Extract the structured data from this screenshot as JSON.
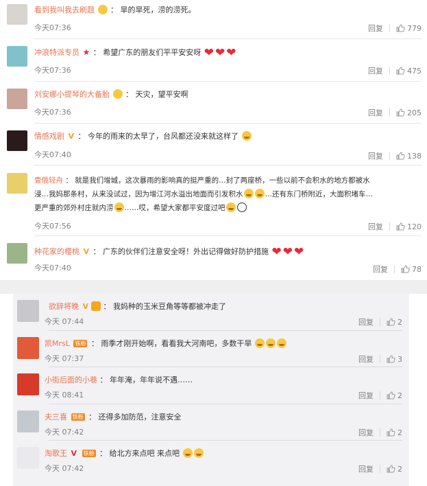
{
  "top_comments": [
    {
      "user": "看到我叫我去刷题",
      "badge": "emoji",
      "text": "旱的旱死，涝的涝死。",
      "time": "今天07:36",
      "reply": "回复",
      "likes": "779",
      "avatar_color": "#d8d4cf"
    },
    {
      "user": "冲浪特派专员",
      "badge": "star",
      "text": "希望广东的朋友们平平安安呀",
      "hearts": 3,
      "time": "今天07:36",
      "reply": "回复",
      "likes": "475",
      "avatar_color": "#7fc2c9"
    },
    {
      "user": "刘安娜小提琴的大备胎",
      "badge": "emoji",
      "text": "天灾，望平安啊",
      "time": "今天07:36",
      "reply": "回复",
      "likes": "205",
      "avatar_color": "#c9a59a"
    },
    {
      "user": "情感戏剧",
      "badge": "v",
      "text": "今年的雨来的太早了，台风都还没来就这样了",
      "time": "今天07:40",
      "reply": "回复",
      "likes": "138",
      "avatar_color": "#2a1a1c"
    },
    {
      "user": "壹俄轻舟",
      "badge": "",
      "text": "就是我们增城，这次暴雨的影响真的挺严重的…封了两座桥，一些以前不会积水的地方都被水",
      "text2": "浸…我妈那条村，从来没试过，因为增江河水溢出地面而引发积水",
      "text2b": "…还有东门桥附近，大面积堵车…",
      "text3": "更严重的郊外村庄就内涝",
      "text3b": "……哎，希望大家都平安度过吧",
      "time": "今天07:56",
      "reply": "回复",
      "likes": "120",
      "avatar_color": "#e8cf6a"
    },
    {
      "user": "种花家的樱桃",
      "badge": "v",
      "text": "广东的伙伴们注意安全呀！外出记得做好防护措施",
      "hearts": 3,
      "time": "今天07:40",
      "reply": "回复",
      "likes": "78",
      "avatar_color": "#9bb58a"
    }
  ],
  "sub_comments": [
    {
      "user": "欲辞将晚",
      "badge": "v",
      "text": "我妈种的玉米豆角等等都被冲走了",
      "time": "今天 07:44",
      "reply": "回复",
      "likes": "2",
      "avatar_color": "#c7c7cc"
    },
    {
      "user": "凯MrsL",
      "badge": "fan",
      "fan_label": "铁粉",
      "text": "雨季才刚开始啊，看看我大河南吧，多数干旱",
      "time": "今天 07:37",
      "reply": "回复",
      "likes": "3",
      "avatar_color": "#e25a3a"
    },
    {
      "user": "小街后面的小巷",
      "badge": "",
      "text": "年年淹，年年说不遇……",
      "time": "今天 08:41",
      "reply": "回复",
      "likes": "2",
      "avatar_color": "#d83a2a"
    },
    {
      "user": "夫三喜",
      "badge": "fan",
      "fan_label": "铁粉",
      "text": "还得多加防范，注意安全",
      "time": "今天 07:42",
      "reply": "回复",
      "likes": "2",
      "avatar_color": "#c4c8cf"
    },
    {
      "user": "淘歌王",
      "badge": "vfan",
      "fan_label": "铁粉",
      "text": "给北方来点吧 来点吧",
      "time": "今天 07:42",
      "reply": "回复",
      "likes": "2",
      "avatar_color": "#e9e9ee"
    }
  ]
}
